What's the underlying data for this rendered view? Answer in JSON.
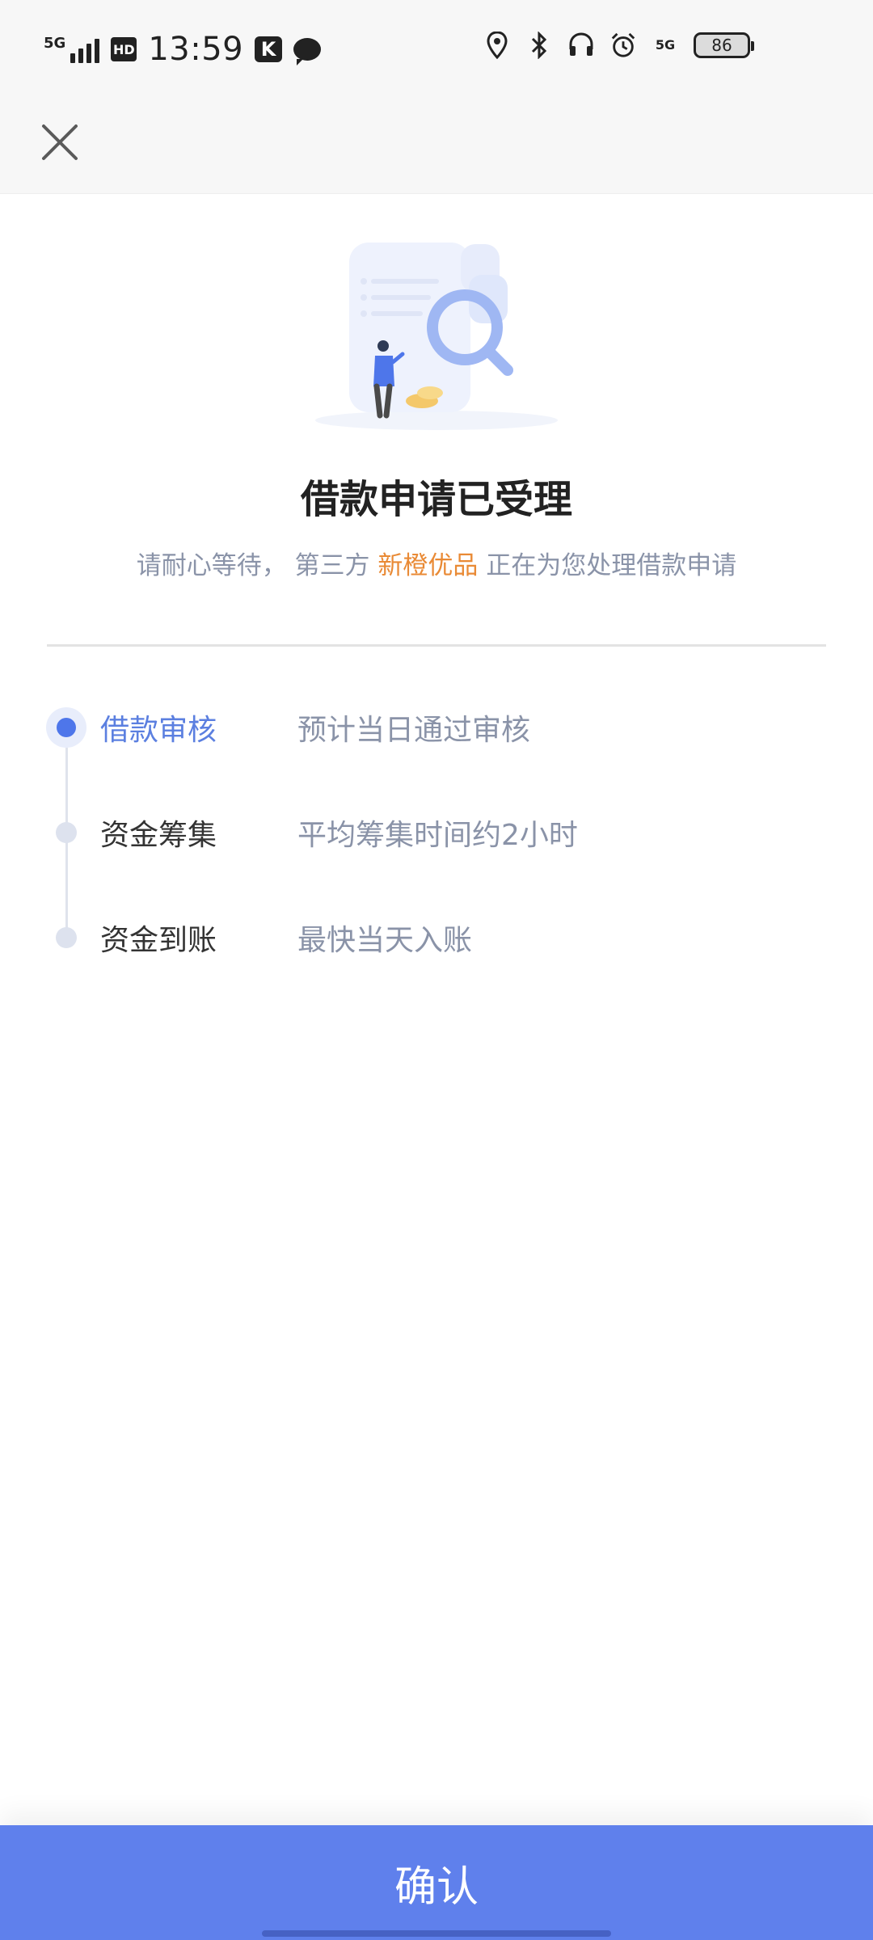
{
  "status_bar": {
    "network_left": "5G",
    "hd": "HD",
    "time": "13:59",
    "app_badge": "K",
    "network_right": "5G",
    "battery": "86"
  },
  "header": {
    "close_icon": "close-icon"
  },
  "result": {
    "title": "借款申请已受理",
    "subtitle_prefix": "请耐心等待， 第三方",
    "subtitle_brand": "新橙优品",
    "subtitle_suffix": "正在为您处理借款申请"
  },
  "steps": [
    {
      "name": "借款审核",
      "desc": "预计当日通过审核",
      "active": true
    },
    {
      "name": "资金筹集",
      "desc": "平均筹集时间约2小时",
      "active": false
    },
    {
      "name": "资金到账",
      "desc": "最快当天入账",
      "active": false
    }
  ],
  "footer": {
    "confirm_label": "确认"
  },
  "colors": {
    "accent": "#5f80ec",
    "active_step": "#4e76ea",
    "brand_text": "#e98a35",
    "muted_text": "#8a93a8"
  }
}
